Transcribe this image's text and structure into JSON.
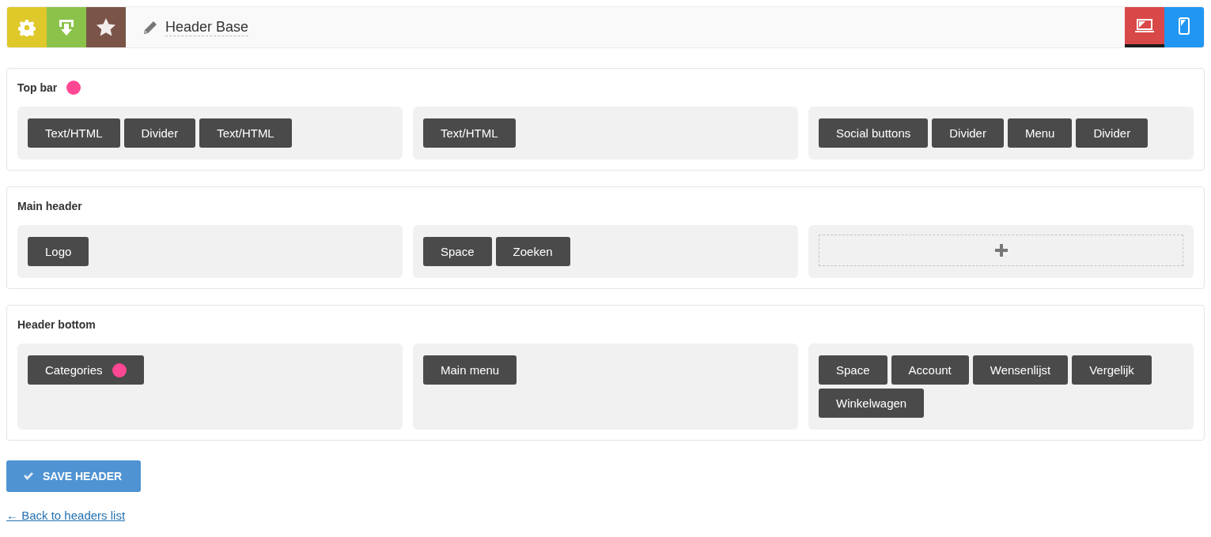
{
  "toolbar": {
    "title": "Header Base",
    "devices": [
      {
        "kind": "desktop",
        "selected": true
      },
      {
        "kind": "mobile",
        "selected": false
      }
    ]
  },
  "sections": [
    {
      "title": "Top bar",
      "marked": true,
      "columns": [
        {
          "elements": [
            {
              "label": "Text/HTML",
              "marked": false
            },
            {
              "label": "Divider",
              "marked": false
            },
            {
              "label": "Text/HTML",
              "marked": false
            }
          ]
        },
        {
          "elements": [
            {
              "label": "Text/HTML",
              "marked": false
            }
          ]
        },
        {
          "elements": [
            {
              "label": "Social buttons",
              "marked": false
            },
            {
              "label": "Divider",
              "marked": false
            },
            {
              "label": "Menu",
              "marked": false
            },
            {
              "label": "Divider",
              "marked": false
            }
          ]
        }
      ]
    },
    {
      "title": "Main header",
      "marked": false,
      "columns": [
        {
          "elements": [
            {
              "label": "Logo",
              "marked": false
            }
          ]
        },
        {
          "elements": [
            {
              "label": "Space",
              "marked": false
            },
            {
              "label": "Zoeken",
              "marked": false
            }
          ]
        },
        {}
      ]
    },
    {
      "title": "Header bottom",
      "marked": false,
      "columns": [
        {
          "elements": [
            {
              "label": "Categories",
              "marked": true
            }
          ]
        },
        {
          "elements": [
            {
              "label": "Main menu",
              "marked": false
            }
          ]
        },
        {
          "elements": [
            {
              "label": "Space",
              "marked": false
            },
            {
              "label": "Account",
              "marked": false
            },
            {
              "label": "Wensenlijst",
              "marked": false
            },
            {
              "label": "Vergelijk",
              "marked": false
            },
            {
              "label": "Winkelwagen",
              "marked": false
            }
          ]
        }
      ]
    }
  ],
  "save_button": "SAVE HEADER",
  "back_link": "← Back to headers list"
}
